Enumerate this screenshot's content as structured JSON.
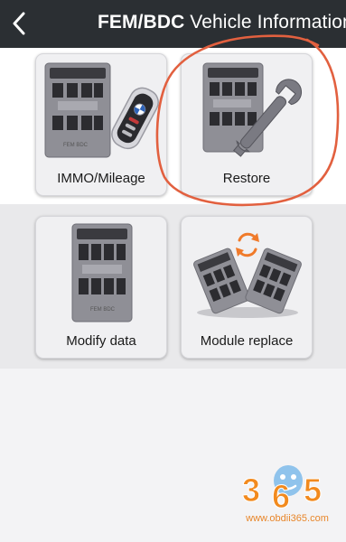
{
  "header": {
    "title_bold": "FEM/BDC",
    "title_rest": " Vehicle Information",
    "back_icon": "chevron-left-icon"
  },
  "tiles": [
    {
      "label": "IMMO/Mileage",
      "icon": "fem-module-with-key-fob-icon"
    },
    {
      "label": "Restore",
      "icon": "fem-module-with-wrench-icon"
    },
    {
      "label": "Modify data",
      "icon": "fem-module-icon"
    },
    {
      "label": "Module replace",
      "icon": "two-modules-swap-icon"
    }
  ],
  "module_caption": "FEM BDC",
  "watermark": {
    "logo_text": "365",
    "url": "www.obdii365.com"
  },
  "colors": {
    "header_bg": "#2b2f33",
    "annotation_circle": "#e2603f",
    "swap_arrows": "#f07a2a",
    "watermark": "#e8862a"
  }
}
